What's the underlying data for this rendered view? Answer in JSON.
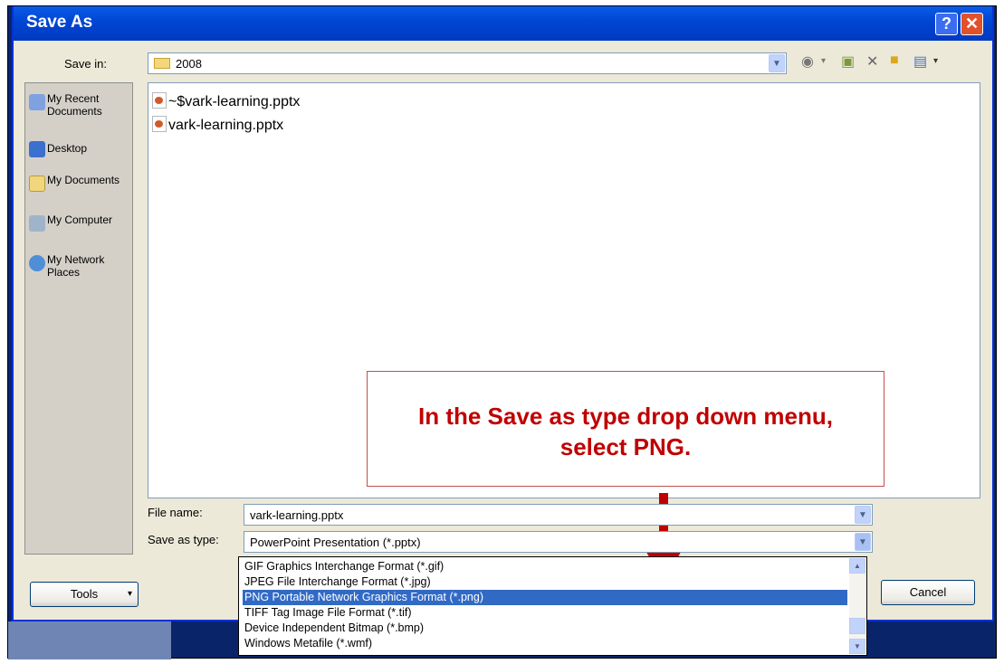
{
  "dialog": {
    "title": "Save As",
    "help_glyph": "?",
    "close_glyph": "✕"
  },
  "save_in": {
    "label": "Save in:",
    "value": "2008"
  },
  "toolbar": {
    "icons": [
      "back-icon",
      "up-folder-icon",
      "delete-icon",
      "new-folder-icon",
      "views-icon"
    ]
  },
  "places": [
    {
      "label": "My Recent Documents",
      "icon": "recent-documents-icon"
    },
    {
      "label": "Desktop",
      "icon": "desktop-icon"
    },
    {
      "label": "My Documents",
      "icon": "my-documents-icon"
    },
    {
      "label": "My Computer",
      "icon": "my-computer-icon"
    },
    {
      "label": "My Network Places",
      "icon": "network-places-icon"
    }
  ],
  "files": [
    {
      "name": "~$vark-learning.pptx"
    },
    {
      "name": "vark-learning.pptx"
    }
  ],
  "callout": {
    "line1": "In the Save as type drop down menu,",
    "line2": "select PNG."
  },
  "file_name": {
    "label": "File name:",
    "value": "vark-learning.pptx"
  },
  "save_as_type": {
    "label": "Save as type:",
    "value": "PowerPoint Presentation (*.pptx)",
    "options": [
      "GIF Graphics Interchange Format (*.gif)",
      "JPEG File Interchange Format (*.jpg)",
      "PNG Portable Network Graphics Format (*.png)",
      "TIFF Tag Image File Format (*.tif)",
      "Device Independent Bitmap (*.bmp)",
      "Windows Metafile (*.wmf)"
    ],
    "selected_index": 2
  },
  "buttons": {
    "tools": "Tools",
    "tools_arrow": "▾",
    "cancel": "Cancel"
  },
  "colors": {
    "title_bar": "#0047d5",
    "selection": "#316ac5",
    "callout_text": "#c00000"
  }
}
